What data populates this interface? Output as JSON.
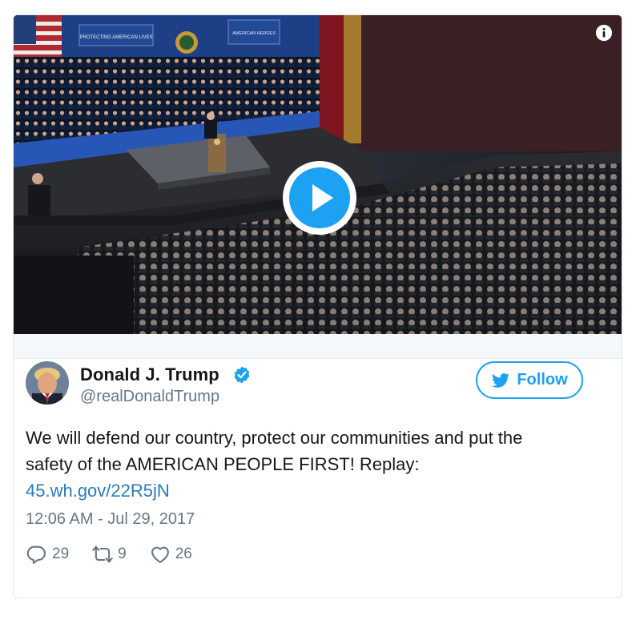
{
  "tweet": {
    "author": {
      "name": "Donald J. Trump",
      "handle": "@realDonaldTrump",
      "verified": true
    },
    "follow_label": "Follow",
    "text_line1": "We will defend our country, protect our communities and put the",
    "text_line2": "safety of the AMERICAN PEOPLE FIRST! Replay:",
    "link": "45.wh.gov/22R5jN",
    "timestamp": "12:06 AM - Jul 29, 2017",
    "stats": {
      "replies": "29",
      "retweets": "9",
      "likes": "26"
    }
  },
  "media": {
    "banner_left": "PROTECTING AMERICAN LIVES",
    "banner_right": "AMERICAN HEROES"
  },
  "icons": {
    "play": "play-icon",
    "info": "info-icon",
    "verified": "verified-badge-icon",
    "bird": "twitter-bird-icon",
    "reply": "reply-icon",
    "retweet": "retweet-icon",
    "like": "heart-icon"
  },
  "colors": {
    "brand_blue": "#1da1f2",
    "link_blue": "#2b7bb9",
    "text_primary": "#14171a",
    "text_secondary": "#657786",
    "card_border": "#e1e8ed"
  }
}
